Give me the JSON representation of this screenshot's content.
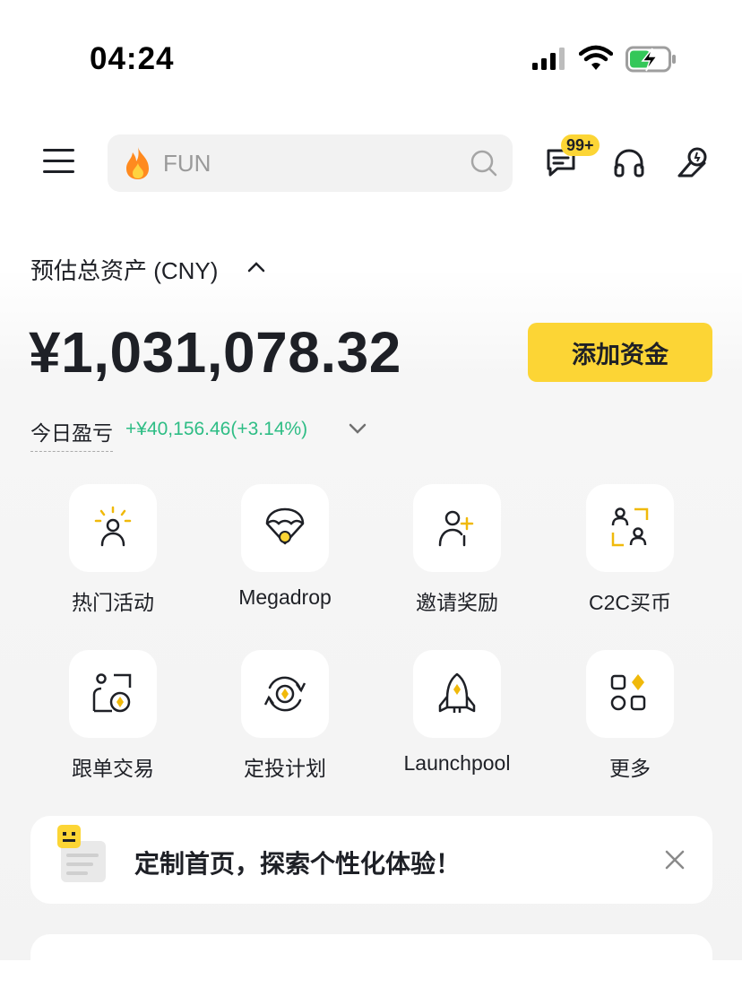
{
  "status_bar": {
    "time": "04:24"
  },
  "header": {
    "search_placeholder": "FUN",
    "notification_badge": "99+"
  },
  "assets": {
    "label": "预估总资产 (CNY)",
    "balance": "¥1,031,078.32",
    "deposit_button": "添加资金",
    "pnl_label": "今日盈亏",
    "pnl_value": "+¥40,156.46(+3.14%)"
  },
  "shortcuts": [
    {
      "label": "热门活动",
      "icon": "spotlight-user-icon"
    },
    {
      "label": "Megadrop",
      "icon": "parachute-icon"
    },
    {
      "label": "邀请奖励",
      "icon": "add-user-icon"
    },
    {
      "label": "C2C买币",
      "icon": "c2c-icon"
    },
    {
      "label": "跟单交易",
      "icon": "copy-trade-icon"
    },
    {
      "label": "定投计划",
      "icon": "auto-invest-icon"
    },
    {
      "label": "Launchpool",
      "icon": "rocket-icon"
    },
    {
      "label": "更多",
      "icon": "more-grid-icon"
    }
  ],
  "banner": {
    "text": "定制首页，探索个性化体验！"
  },
  "colors": {
    "accent": "#fcd535",
    "positive": "#2ebd85",
    "text": "#1e2026"
  }
}
